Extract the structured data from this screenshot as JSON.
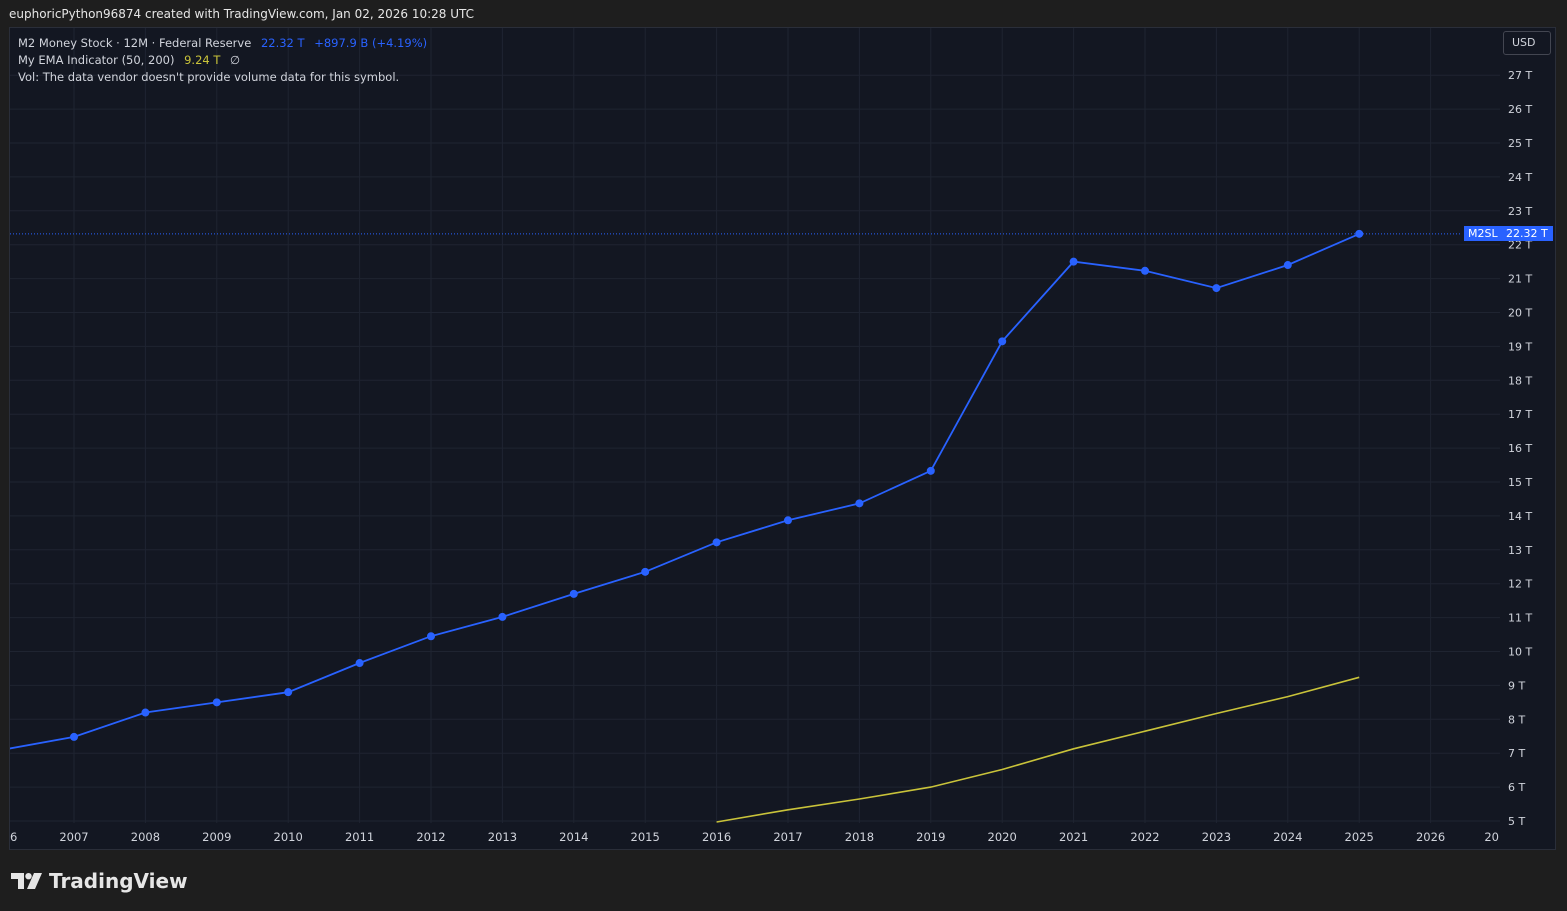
{
  "header": {
    "attribution": "euphoricPython96874 created with TradingView.com, Jan 02, 2026 10:28 UTC"
  },
  "legend": {
    "series_title": "M2 Money Stock · 12M · Federal Reserve",
    "series_value": "22.32 T",
    "series_change": "+897.9 B (+4.19%)",
    "indicator_title": "My EMA Indicator (50, 200)",
    "indicator_value": "9.24 T",
    "indicator_symbol": "∅",
    "volume_note": "Vol: The data vendor doesn't provide volume data for this symbol."
  },
  "currency_button": "USD",
  "price_tag": {
    "symbol": "M2SL",
    "value": "22.32 T"
  },
  "brand": {
    "name": "TradingView"
  },
  "colors": {
    "series": "#2962ff",
    "indicator": "#c9c33a",
    "background": "#131722",
    "grid": "#1f2431",
    "axis_text": "#d1d4dc"
  },
  "chart_data": {
    "type": "line",
    "y_ticks": [
      "5 T",
      "6 T",
      "7 T",
      "8 T",
      "9 T",
      "10 T",
      "11 T",
      "12 T",
      "13 T",
      "14 T",
      "15 T",
      "16 T",
      "17 T",
      "18 T",
      "19 T",
      "20 T",
      "21 T",
      "22 T",
      "23 T",
      "24 T",
      "25 T",
      "26 T",
      "27 T"
    ],
    "x_ticks": [
      "6",
      "2007",
      "2008",
      "2009",
      "2010",
      "2011",
      "2012",
      "2013",
      "2014",
      "2015",
      "2016",
      "2017",
      "2018",
      "2019",
      "2020",
      "2021",
      "2022",
      "2023",
      "2024",
      "2025",
      "2026",
      "20"
    ],
    "ylim": [
      5,
      27.5
    ],
    "xlim": [
      2005.85,
      2026.85
    ],
    "series": [
      {
        "name": "M2 Money Stock",
        "markers": true,
        "x": [
          2006,
          2007,
          2008,
          2009,
          2010,
          2011,
          2012,
          2013,
          2014,
          2015,
          2016,
          2017,
          2018,
          2019,
          2020,
          2021,
          2022,
          2023,
          2024,
          2025
        ],
        "y": [
          7.1,
          7.48,
          8.2,
          8.5,
          8.8,
          9.66,
          10.45,
          11.02,
          11.7,
          12.35,
          13.22,
          13.87,
          14.37,
          15.33,
          19.15,
          21.5,
          21.23,
          20.72,
          21.4,
          22.32
        ]
      },
      {
        "name": "My EMA Indicator (50, 200)",
        "markers": false,
        "x": [
          2016,
          2017,
          2018,
          2019,
          2020,
          2021,
          2022,
          2023,
          2024,
          2025
        ],
        "y": [
          4.97,
          5.33,
          5.65,
          6.0,
          6.52,
          7.13,
          7.65,
          8.17,
          8.67,
          9.24
        ]
      }
    ],
    "price_line": 22.32
  }
}
